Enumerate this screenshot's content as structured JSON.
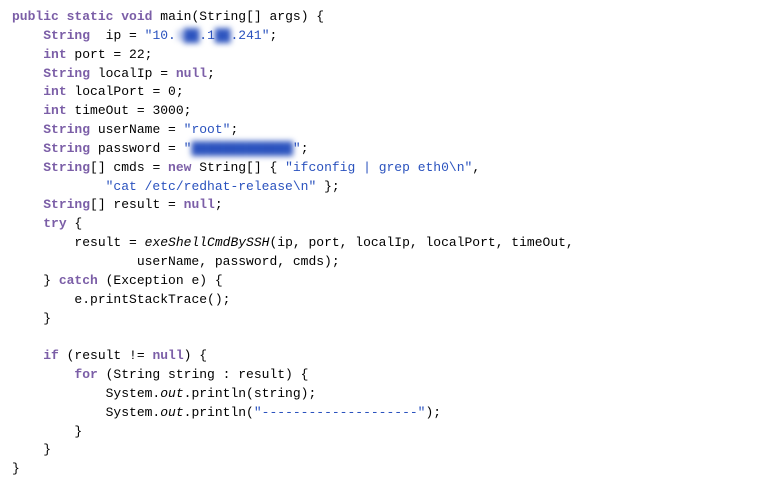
{
  "code": {
    "lines": [
      {
        "id": 1,
        "text": "public static void main(String[] args) {"
      },
      {
        "id": 2,
        "text": "    String ip = \"10.1███.1██.241\";",
        "has_blur": true
      },
      {
        "id": 3,
        "text": "    int port = 22;"
      },
      {
        "id": 4,
        "text": "    String localIp = null;"
      },
      {
        "id": 5,
        "text": "    int localPort = 0;"
      },
      {
        "id": 6,
        "text": "    int timeOut = 3000;"
      },
      {
        "id": 7,
        "text": "    String userName = \"root\";"
      },
      {
        "id": 8,
        "text": "    String password = \"█████████████\";",
        "has_blur": true
      },
      {
        "id": 9,
        "text": "    String[] cmds = new String[] { \"ifconfig | grep eth0\\n\","
      },
      {
        "id": 10,
        "text": "            \"cat /etc/redhat-release\\n\" };"
      },
      {
        "id": 11,
        "text": "    String[] result = null;"
      },
      {
        "id": 12,
        "text": "    try {"
      },
      {
        "id": 13,
        "text": "        result = exeShellCmdBySSH(ip, port, localIp, localPort, timeOut,"
      },
      {
        "id": 14,
        "text": "                userName, password, cmds);"
      },
      {
        "id": 15,
        "text": "    } catch (Exception e) {"
      },
      {
        "id": 16,
        "text": "        e.printStackTrace();"
      },
      {
        "id": 17,
        "text": "    }"
      },
      {
        "id": 18,
        "text": ""
      },
      {
        "id": 19,
        "text": "    if (result != null) {"
      },
      {
        "id": 20,
        "text": "        for (String string : result) {"
      },
      {
        "id": 21,
        "text": "            System.out.println(string);"
      },
      {
        "id": 22,
        "text": "            System.out.println(\"--------------------\");"
      },
      {
        "id": 23,
        "text": "        }"
      },
      {
        "id": 24,
        "text": "    }"
      },
      {
        "id": 25,
        "text": "}"
      }
    ]
  }
}
